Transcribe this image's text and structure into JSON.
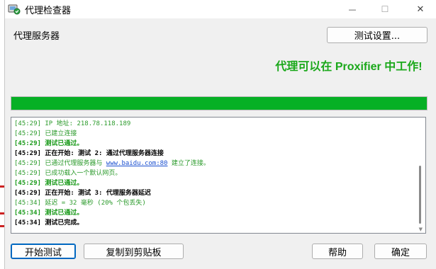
{
  "window": {
    "title": "代理检查器",
    "minimize_glyph": "—",
    "maximize_glyph": "☐",
    "close_glyph": "✕"
  },
  "server_label": "代理服务器",
  "settings_button": "测试设置...",
  "status": {
    "text": "代理可以在 Proxifier 中工作!",
    "color": "#1aa81a"
  },
  "progress": {
    "percent": 100,
    "color": "#06b025"
  },
  "log": [
    {
      "type": "info",
      "text": "[45:29] IP 地址: 218.78.118.189"
    },
    {
      "type": "info",
      "text": "[45:29] 已建立连接"
    },
    {
      "type": "ok",
      "text": "[45:29] 测试已通过。"
    },
    {
      "type": "hd",
      "text": "[45:29] 正在开始: 测试 2: 通过代理服务器连接"
    },
    {
      "type": "info",
      "text": "[45:29] 已通过代理服务器与 ",
      "link": "www.baidu.com:80",
      "after": " 建立了连接。"
    },
    {
      "type": "info",
      "text": "[45:29] 已成功载入一个默认网页。"
    },
    {
      "type": "ok",
      "text": "[45:29] 测试已通过。"
    },
    {
      "type": "hd",
      "text": "[45:29] 正在开始: 测试 3: 代理服务器延迟"
    },
    {
      "type": "info",
      "text": "[45:34] 延迟 = 32 毫秒 (20% 个包丢失)"
    },
    {
      "type": "ok",
      "text": "[45:34] 测试已通过。"
    },
    {
      "type": "hd",
      "text": "[45:34] 测试已完成。"
    }
  ],
  "buttons": {
    "start": "开始测试",
    "copy": "复制到剪贴板",
    "help": "帮助",
    "ok": "确定"
  },
  "icons": {
    "app": "proxy-checker-icon"
  }
}
